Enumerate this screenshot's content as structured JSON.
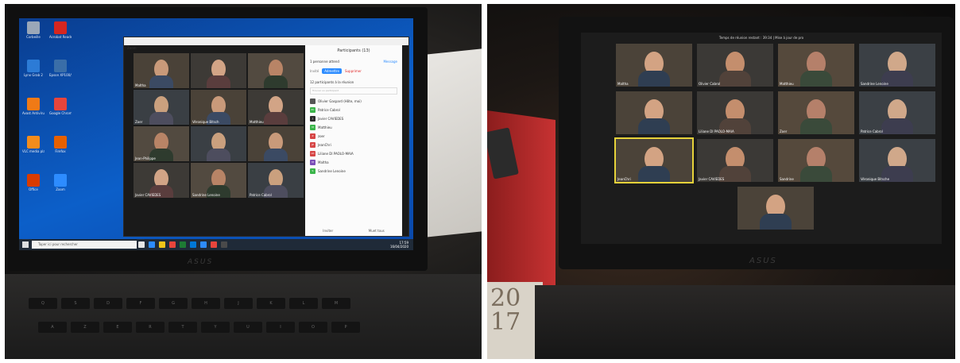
{
  "left_photo": {
    "desktop_icons": [
      {
        "label": "Corbeille",
        "icon": "recycle-bin-icon",
        "color": "#9aa7b8"
      },
      {
        "label": "Acrobat Reader DC",
        "icon": "pdf-icon",
        "color": "#d6261f"
      },
      {
        "label": "Lynx Grab 2",
        "icon": "lynx-icon",
        "color": "#2c7bd6"
      },
      {
        "label": "Epson XP100/Sea",
        "icon": "printer-icon",
        "color": "#3a6ea8"
      },
      {
        "label": "Avast Antivirus Gratuit",
        "icon": "avast-icon",
        "color": "#f07a16"
      },
      {
        "label": "Google Chrome",
        "icon": "chrome-icon",
        "color": "#e8453c"
      },
      {
        "label": "VLC media player",
        "icon": "vlc-icon",
        "color": "#f28c1c"
      },
      {
        "label": "Firefox",
        "icon": "firefox-icon",
        "color": "#e66000"
      },
      {
        "label": "Office",
        "icon": "office-icon",
        "color": "#d83b01"
      },
      {
        "label": "Zoom",
        "icon": "zoom-icon",
        "color": "#2d8cff"
      }
    ],
    "zoom_window": {
      "participant_tiles": [
        {
          "name": "Maltha"
        },
        {
          "name": ""
        },
        {
          "name": ""
        },
        {
          "name": "Zoer"
        },
        {
          "name": "Véronique Bitsch"
        },
        {
          "name": "Matthieu"
        },
        {
          "name": "Jean-Philippe"
        },
        {
          "name": ""
        },
        {
          "name": ""
        },
        {
          "name": "Javier CAVIEDES"
        },
        {
          "name": "Sandrine Lenoine"
        },
        {
          "name": "Patrice Cabrol"
        }
      ],
      "panel": {
        "title": "Participants (13)",
        "waiting_text": "1 personne attend",
        "message_label": "Message",
        "waiting_name": "Invité",
        "admit_label": "Admettre",
        "remove_label": "Supprimer",
        "meeting_count": "12 participants à la réunion",
        "search_placeholder": "Trouver un participant",
        "participants": [
          {
            "initials": "",
            "name": "Olivier Gaspard (Hôte, moi)",
            "color": "#555555"
          },
          {
            "initials": "PC",
            "name": "Patrice Cabrol",
            "color": "#3bb54a"
          },
          {
            "initials": "J",
            "name": "Javier CAVIEDES",
            "color": "#2b2b2b"
          },
          {
            "initials": "M",
            "name": "Matthieu",
            "color": "#3bb54a"
          },
          {
            "initials": "Z",
            "name": "zoer",
            "color": "#d64545"
          },
          {
            "initials": "JP",
            "name": "JeanChri",
            "color": "#d64545"
          },
          {
            "initials": "LD",
            "name": "Liliane DI PAOLO-MAIA",
            "color": "#d64545"
          },
          {
            "initials": "M",
            "name": "Maltha",
            "color": "#7b4fb8"
          },
          {
            "initials": "S",
            "name": "Sandrine Lenoine",
            "color": "#3bb54a"
          }
        ],
        "invite_label": "Inviter",
        "mute_label": "Muet tous"
      }
    },
    "taskbar": {
      "search_placeholder": "Taper ici pour rechercher",
      "time": "17:59",
      "date": "16/04/2020",
      "app_colors": [
        "#e6e6e6",
        "#2d8cff",
        "#f0c419",
        "#e8453c",
        "#1e7b34",
        "#0078d7",
        "#2d8cff",
        "#e8453c",
        "#4a4a4a"
      ]
    },
    "brand": "ASUS",
    "keyboard_rows": [
      [
        "Q",
        "S",
        "D",
        "F",
        "G",
        "H",
        "J",
        "K",
        "L",
        "M"
      ],
      [
        "A",
        "Z",
        "E",
        "R",
        "T",
        "Y",
        "U",
        "I",
        "O",
        "P"
      ]
    ]
  },
  "right_photo": {
    "meeting_time": "Temps de réunion restant : 39:34 | Mise à jour de pro",
    "tiles": [
      {
        "name": "Maltha",
        "active": false
      },
      {
        "name": "Olivier Cabrol",
        "active": false
      },
      {
        "name": "Matthieu",
        "active": false
      },
      {
        "name": "Sandrine Lenoine",
        "active": false
      },
      {
        "name": "",
        "active": false
      },
      {
        "name": "Liliane DI PAOLO-MAIA",
        "active": false
      },
      {
        "name": "Zoer",
        "active": false
      },
      {
        "name": "Patrice Cabrol",
        "active": false
      },
      {
        "name": "JeanChri",
        "active": true
      },
      {
        "name": "Javier CAVIEDES",
        "active": false
      },
      {
        "name": "Sandrine",
        "active": false
      },
      {
        "name": "Véronique Bitsche",
        "active": false
      },
      {
        "name": "",
        "active": false
      }
    ],
    "brand": "ASUS",
    "calendar_text": "20\n17"
  }
}
